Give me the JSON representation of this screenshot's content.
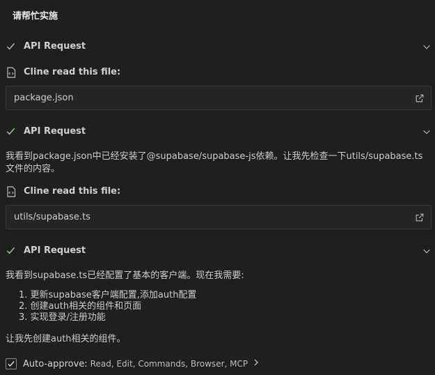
{
  "header": {
    "title": "请帮忙实施"
  },
  "sections": [
    {
      "type": "api",
      "label": "API Request"
    },
    {
      "type": "file_read",
      "label": "Cline read this file:",
      "file": "package.json"
    },
    {
      "type": "api",
      "label": "API Request"
    },
    {
      "type": "message",
      "text": "我看到package.json中已经安装了@supabase/supabase-js依赖。让我先检查一下utils/supabase.ts文件的内容。"
    },
    {
      "type": "file_read",
      "label": "Cline read this file:",
      "file": "utils/supabase.ts"
    },
    {
      "type": "api",
      "label": "API Request"
    },
    {
      "type": "message",
      "text": "我看到supabase.ts已经配置了基本的客户端。现在我需要:"
    },
    {
      "type": "list",
      "items": [
        "1. 更新supabase客户端配置,添加auth配置",
        "2. 创建auth相关的组件和页面",
        "3. 实现登录/注册功能"
      ]
    },
    {
      "type": "message",
      "text": "让我先创建auth相关的组件。"
    }
  ],
  "auto_approve": {
    "label": "Auto-approve:",
    "value": "Read, Edit, Commands, Browser, MCP",
    "checked": true
  },
  "colors": {
    "background": "#1f1f1f",
    "success_check": "#89d185",
    "text": "#cccccc"
  },
  "icons": {
    "check": "check-icon",
    "chevron": "chevron-down-icon",
    "file": "file-code-icon",
    "external": "link-external-icon"
  }
}
